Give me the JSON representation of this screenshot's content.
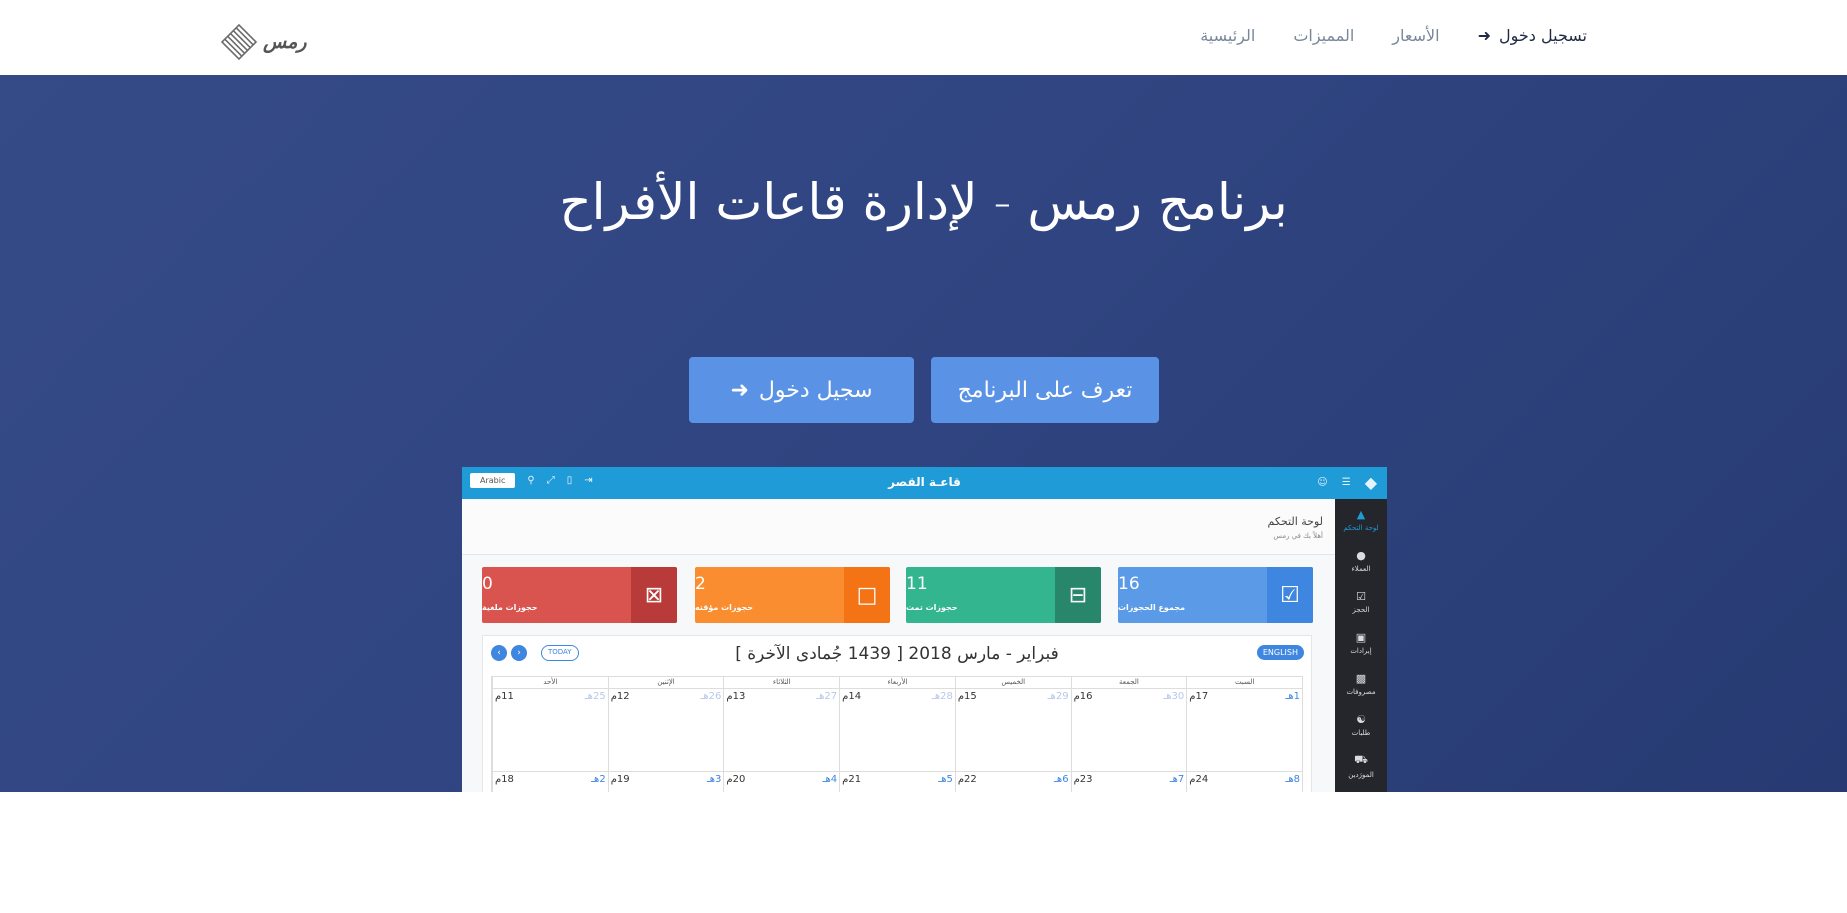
{
  "brand": {
    "name": "رمس"
  },
  "nav": {
    "items": [
      "الرئيسية",
      "المميزات",
      "الأسعار"
    ],
    "login": "تسجيل دخول"
  },
  "hero": {
    "title": "برنامج رمس - لإدارة قاعات الأفراح",
    "learn_button": "تعرف على البرنامج",
    "login_button": "سجيل دخول"
  },
  "app": {
    "title": "قاعـة القصر",
    "lang_button": "Arabic",
    "sidebar": [
      {
        "label": "لوحة التحكم",
        "icon": "dashboard-icon",
        "active": true
      },
      {
        "label": "العملاء",
        "icon": "user-icon"
      },
      {
        "label": "الحجز",
        "icon": "calendar-check-icon"
      },
      {
        "label": "إيرادات",
        "icon": "money-icon"
      },
      {
        "label": "مصروفات",
        "icon": "bar-chart-icon"
      },
      {
        "label": "طلبات",
        "icon": "request-icon"
      },
      {
        "label": "المورَدين",
        "icon": "truck-icon"
      }
    ],
    "page_title": "لوحة التحكم",
    "page_subtitle": "أهلاً بك في رمس",
    "stats": [
      {
        "value": "16",
        "label": "مجموع الحجوزات",
        "icon": "calendar-check-icon"
      },
      {
        "value": "11",
        "label": "حجوزات تمت",
        "icon": "calendar-minus-icon"
      },
      {
        "value": "2",
        "label": "حجوزات مؤقته",
        "icon": "calendar-icon"
      },
      {
        "value": "0",
        "label": "حجوزات ملغية",
        "icon": "calendar-times-icon"
      }
    ],
    "calendar": {
      "title": "فبراير - مارس 2018 [ 1439 جُمادى الآخرة ]",
      "english_button": "ENGLISH",
      "today_button": "TODAY",
      "days": [
        "السبت",
        "الجمعة",
        "الخميس",
        "الأربعاء",
        "الثلاثاء",
        "الإثنين",
        "الأحد"
      ],
      "week1": [
        {
          "g": "17م",
          "h": "1هـ",
          "muted": false
        },
        {
          "g": "16م",
          "h": "30هـ",
          "muted": true
        },
        {
          "g": "15م",
          "h": "29هـ",
          "muted": true
        },
        {
          "g": "14م",
          "h": "28هـ",
          "muted": true
        },
        {
          "g": "13م",
          "h": "27هـ",
          "muted": true
        },
        {
          "g": "12م",
          "h": "26هـ",
          "muted": true
        },
        {
          "g": "11م",
          "h": "25هـ",
          "muted": true
        }
      ],
      "week2": [
        {
          "g": "24م",
          "h": "8هـ",
          "muted": false
        },
        {
          "g": "23م",
          "h": "7هـ",
          "muted": false
        },
        {
          "g": "22م",
          "h": "6هـ",
          "muted": false
        },
        {
          "g": "21م",
          "h": "5هـ",
          "muted": false
        },
        {
          "g": "20م",
          "h": "4هـ",
          "muted": false
        },
        {
          "g": "19م",
          "h": "3هـ",
          "muted": false
        },
        {
          "g": "18م",
          "h": "2هـ",
          "muted": false
        }
      ]
    }
  }
}
